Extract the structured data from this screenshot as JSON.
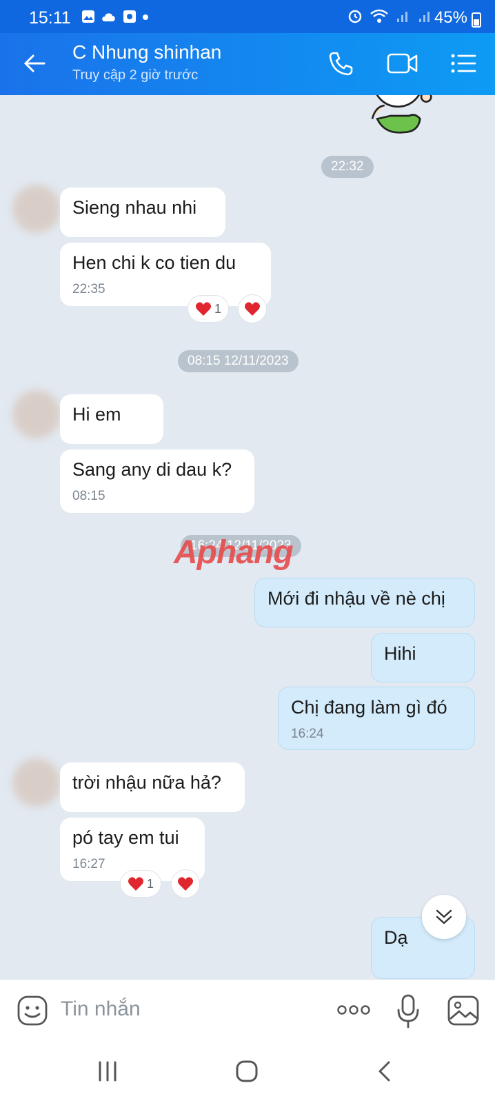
{
  "status": {
    "time": "15:11",
    "battery": "45%"
  },
  "header": {
    "title": "C Nhung shinhan",
    "subtitle": "Truy cập 2 giờ trước"
  },
  "messages": {
    "ts1": "22:32",
    "m1": "Sieng nhau nhi",
    "m2": "Hen chi k co tien du",
    "m2_time": "22:35",
    "m2_react_count": "1",
    "ts2": "08:15 12/11/2023",
    "m3": "Hi em",
    "m4": "Sang any di dau k?",
    "m4_time": "08:15",
    "ts3": "16:24 12/11/2023",
    "m5": "Mới đi nhậu về nè chị",
    "m6": "Hihi",
    "m7": "Chị đang làm gì đó",
    "m7_time": "16:24",
    "m8": "trời nhậu nữa hả?",
    "m9": "pó tay em tui",
    "m9_time": "16:27",
    "m9_react_count": "1",
    "m10": "Dạ"
  },
  "watermark": {
    "part1": "Aphang",
    "part2": ""
  },
  "composer": {
    "placeholder": "Tin nhắn"
  },
  "colors": {
    "header": "#1a72ea",
    "my_bubble": "#d3ebfb",
    "bg": "#e2e9f1"
  }
}
